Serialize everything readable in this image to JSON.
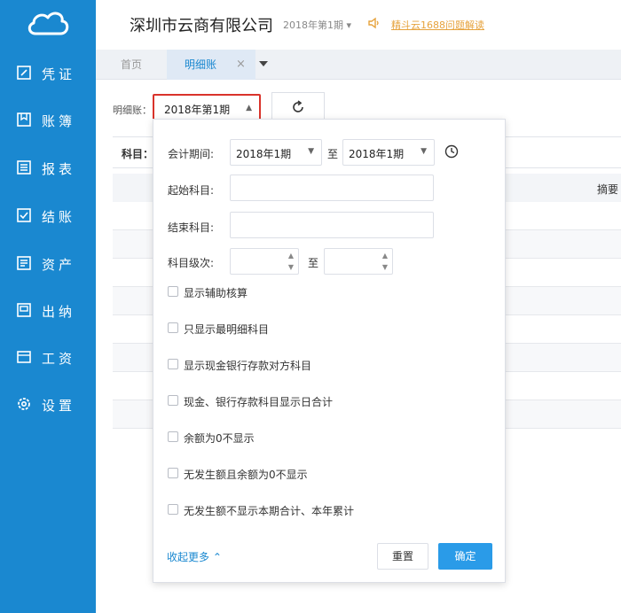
{
  "sidebar": {
    "items": [
      {
        "label": "凭证",
        "icon": "edit-icon"
      },
      {
        "label": "账簿",
        "icon": "ledger-icon"
      },
      {
        "label": "报表",
        "icon": "report-icon"
      },
      {
        "label": "结账",
        "icon": "check-icon"
      },
      {
        "label": "资产",
        "icon": "asset-icon"
      },
      {
        "label": "出纳",
        "icon": "cashier-icon"
      },
      {
        "label": "工资",
        "icon": "salary-icon"
      },
      {
        "label": "设置",
        "icon": "gear-icon"
      }
    ]
  },
  "header": {
    "company": "深圳市云商有限公司",
    "period": "2018年第1期",
    "notice": "精斗云1688问题解读"
  },
  "tabs": {
    "home": "首页",
    "active": "明细账",
    "close": "×"
  },
  "toolbar": {
    "label": "明细账：",
    "period_value": "2018年第1期"
  },
  "table": {
    "subject_label": "科目：",
    "summary_col": "摘要"
  },
  "panel": {
    "period_label": "会计期间:",
    "period_from": "2018年1期",
    "to_label": "至",
    "period_to": "2018年1期",
    "start_subject_label": "起始科目:",
    "start_subject_value": "",
    "end_subject_label": "结束科目:",
    "end_subject_value": "",
    "level_label": "科目级次:",
    "level_to_label": "至",
    "checkboxes": [
      "显示辅助核算",
      "只显示最明细科目",
      "显示现金银行存款对方科目",
      "现金、银行存款科目显示日合计",
      "余额为0不显示",
      "无发生额且余额为0不显示",
      "无发生额不显示本期合计、本年累计"
    ],
    "collapse": "收起更多",
    "reset": "重置",
    "ok": "确定"
  },
  "colors": {
    "sidebar_bg": "#1a88d0",
    "accent": "#2a9be8",
    "highlight_border": "#d9332b",
    "notice": "#e6a23c"
  }
}
